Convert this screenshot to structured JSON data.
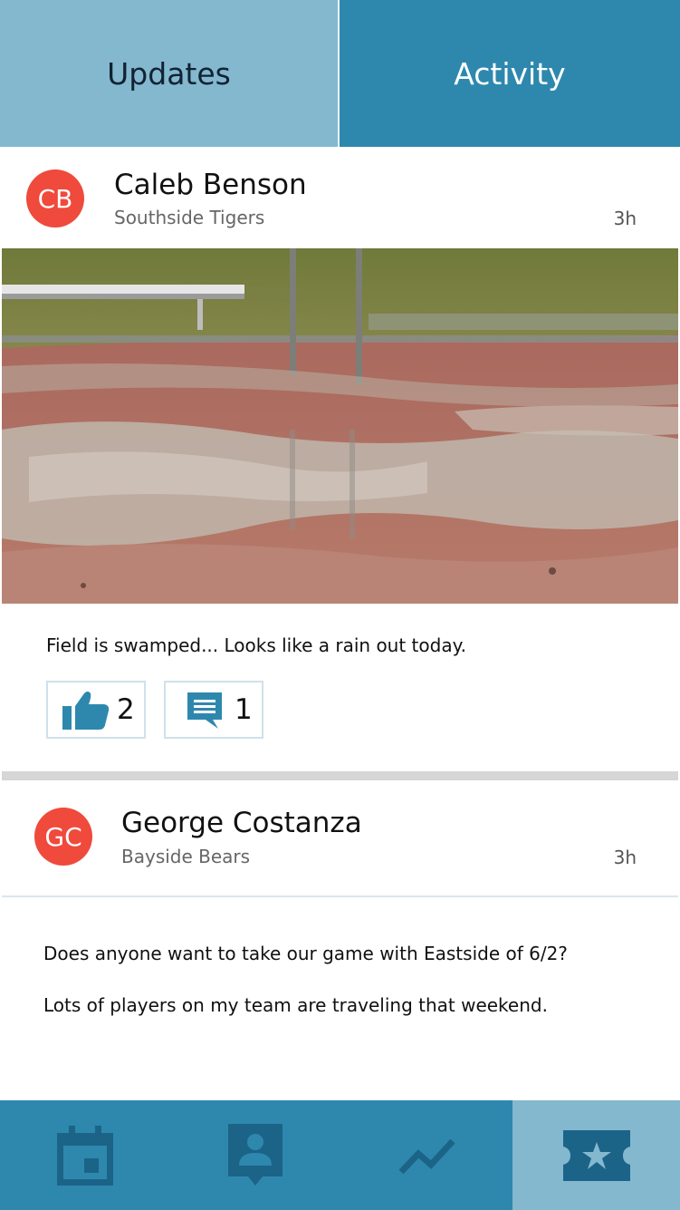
{
  "tabs": {
    "updates": "Updates",
    "activity": "Activity"
  },
  "posts": [
    {
      "initials": "CB",
      "author": "Caleb Benson",
      "team": "Southside Tigers",
      "time": "3h",
      "text": "Field is swamped... Looks like a rain out today.",
      "likes": "2",
      "comments": "1"
    },
    {
      "initials": "GC",
      "author": "George Costanza",
      "team": "Bayside Bears",
      "time": "3h",
      "lines": [
        "Does anyone want to take our game with Eastside of 6/2?",
        "Lots of players on my team are traveling that weekend."
      ]
    }
  ],
  "nav": {
    "items": [
      "calendar-icon",
      "contact-icon",
      "trend-icon",
      "ticket-star-icon"
    ],
    "active_index": 3
  },
  "colors": {
    "tab_inactive": "#83b8cf",
    "tab_active": "#2e88ae",
    "avatar": "#ef4a3c",
    "nav_icon": "#1c6388"
  }
}
